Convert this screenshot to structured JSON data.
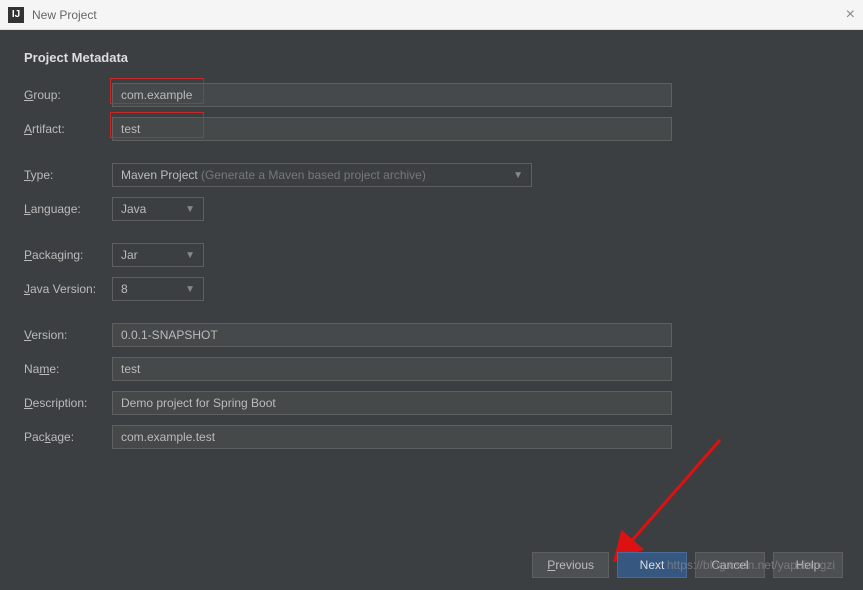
{
  "window": {
    "title": "New Project",
    "icon_text": "IJ"
  },
  "heading": "Project Metadata",
  "fields": {
    "group": {
      "label": "Group:",
      "underline": "G",
      "value": "com.example"
    },
    "artifact": {
      "label": "Artifact:",
      "underline": "A",
      "value": "test"
    },
    "type": {
      "label": "Type:",
      "underline": "T",
      "value": "Maven Project",
      "hint": "(Generate a Maven based project archive)"
    },
    "language": {
      "label": "Language:",
      "underline": "L",
      "value": "Java"
    },
    "packaging": {
      "label": "Packaging:",
      "underline": "P",
      "value": "Jar"
    },
    "java_version": {
      "label": "Java Version:",
      "underline": "J",
      "value": "8"
    },
    "version": {
      "label": "Version:",
      "underline": "V",
      "value": "0.0.1-SNAPSHOT"
    },
    "name": {
      "label": "Name:",
      "underline": "m",
      "before": "Na",
      "after": "e:",
      "value": "test"
    },
    "description": {
      "label": "Description:",
      "underline": "D",
      "value": "Demo project for Spring Boot"
    },
    "package": {
      "label": "Package:",
      "underline": "k",
      "before": "Pac",
      "after": "age:",
      "value": "com.example.test"
    }
  },
  "buttons": {
    "previous": "Previous",
    "next": "Next",
    "cancel": "Cancel",
    "help": "Help"
  },
  "watermark": "https://blog.csdn.net/yapaiangzi"
}
